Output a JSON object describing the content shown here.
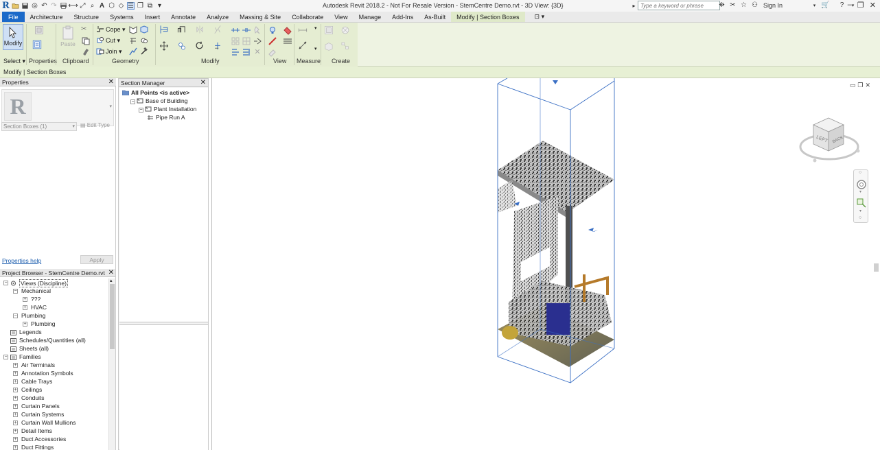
{
  "app": {
    "title": "Autodesk Revit 2018.2 - Not For Resale Version -    StemCentre Demo.rvt - 3D View: {3D}",
    "search_placeholder": "Type a keyword or phrase",
    "sign_in": "Sign In"
  },
  "tabs": [
    "File",
    "Architecture",
    "Structure",
    "Systems",
    "Insert",
    "Annotate",
    "Analyze",
    "Massing & Site",
    "Collaborate",
    "View",
    "Manage",
    "Add-Ins",
    "As-Built",
    "Modify | Section Boxes"
  ],
  "active_tab": "Modify | Section Boxes",
  "ribbon": {
    "modify_button": "Modify",
    "select_label": "Select",
    "properties_button": "Properties",
    "paste_button": "Paste",
    "cope": "Cope",
    "cut": "Cut",
    "join": "Join",
    "panels": {
      "select": "Select",
      "properties": "Properties",
      "clipboard": "Clipboard",
      "geometry": "Geometry",
      "modify": "Modify",
      "view": "View",
      "measure": "Measure",
      "create": "Create"
    }
  },
  "context_bar": "Modify | Section Boxes",
  "properties": {
    "title": "Properties",
    "type_selector": "Section Boxes (1)",
    "edit_type": "Edit Type",
    "help_link": "Properties help",
    "apply": "Apply"
  },
  "section_manager": {
    "title": "Section Manager",
    "items": [
      {
        "label": "All Points <is active>",
        "level": 0,
        "bold": true
      },
      {
        "label": "Base of Building",
        "level": 1
      },
      {
        "label": "Plant Installation",
        "level": 2
      },
      {
        "label": "Pipe Run A",
        "level": 3
      }
    ]
  },
  "project_browser": {
    "title": "Project Browser - StemCentre Demo.rvt",
    "items": [
      {
        "label": "Views (Discipline)",
        "level": 0,
        "toggle": "−",
        "icon": "views"
      },
      {
        "label": "Mechanical",
        "level": 1,
        "toggle": "−"
      },
      {
        "label": "???",
        "level": 2,
        "toggle": "+"
      },
      {
        "label": "HVAC",
        "level": 2,
        "toggle": "+"
      },
      {
        "label": "Plumbing",
        "level": 1,
        "toggle": "−"
      },
      {
        "label": "Plumbing",
        "level": 2,
        "toggle": "+"
      },
      {
        "label": "Legends",
        "level": 0,
        "toggle": "",
        "icon": "doc"
      },
      {
        "label": "Schedules/Quantities (all)",
        "level": 0,
        "toggle": "",
        "icon": "doc"
      },
      {
        "label": "Sheets (all)",
        "level": 0,
        "toggle": "",
        "icon": "doc"
      },
      {
        "label": "Families",
        "level": 0,
        "toggle": "−",
        "icon": "doc"
      },
      {
        "label": "Air Terminals",
        "level": 1,
        "toggle": "+"
      },
      {
        "label": "Annotation Symbols",
        "level": 1,
        "toggle": "+"
      },
      {
        "label": "Cable Trays",
        "level": 1,
        "toggle": "+"
      },
      {
        "label": "Ceilings",
        "level": 1,
        "toggle": "+"
      },
      {
        "label": "Conduits",
        "level": 1,
        "toggle": "+"
      },
      {
        "label": "Curtain Panels",
        "level": 1,
        "toggle": "+"
      },
      {
        "label": "Curtain Systems",
        "level": 1,
        "toggle": "+"
      },
      {
        "label": "Curtain Wall Mullions",
        "level": 1,
        "toggle": "+"
      },
      {
        "label": "Detail Items",
        "level": 1,
        "toggle": "+"
      },
      {
        "label": "Duct Accessories",
        "level": 1,
        "toggle": "+"
      },
      {
        "label": "Duct Fittings",
        "level": 1,
        "toggle": "+"
      }
    ]
  },
  "viewcube": {
    "face_left": "LEFT",
    "face_right": "BACK"
  },
  "colors": {
    "file_tab": "#1b69c9",
    "ribbon": "#e5edd2",
    "link": "#1a5cad",
    "section_box": "#3a6fc4"
  }
}
